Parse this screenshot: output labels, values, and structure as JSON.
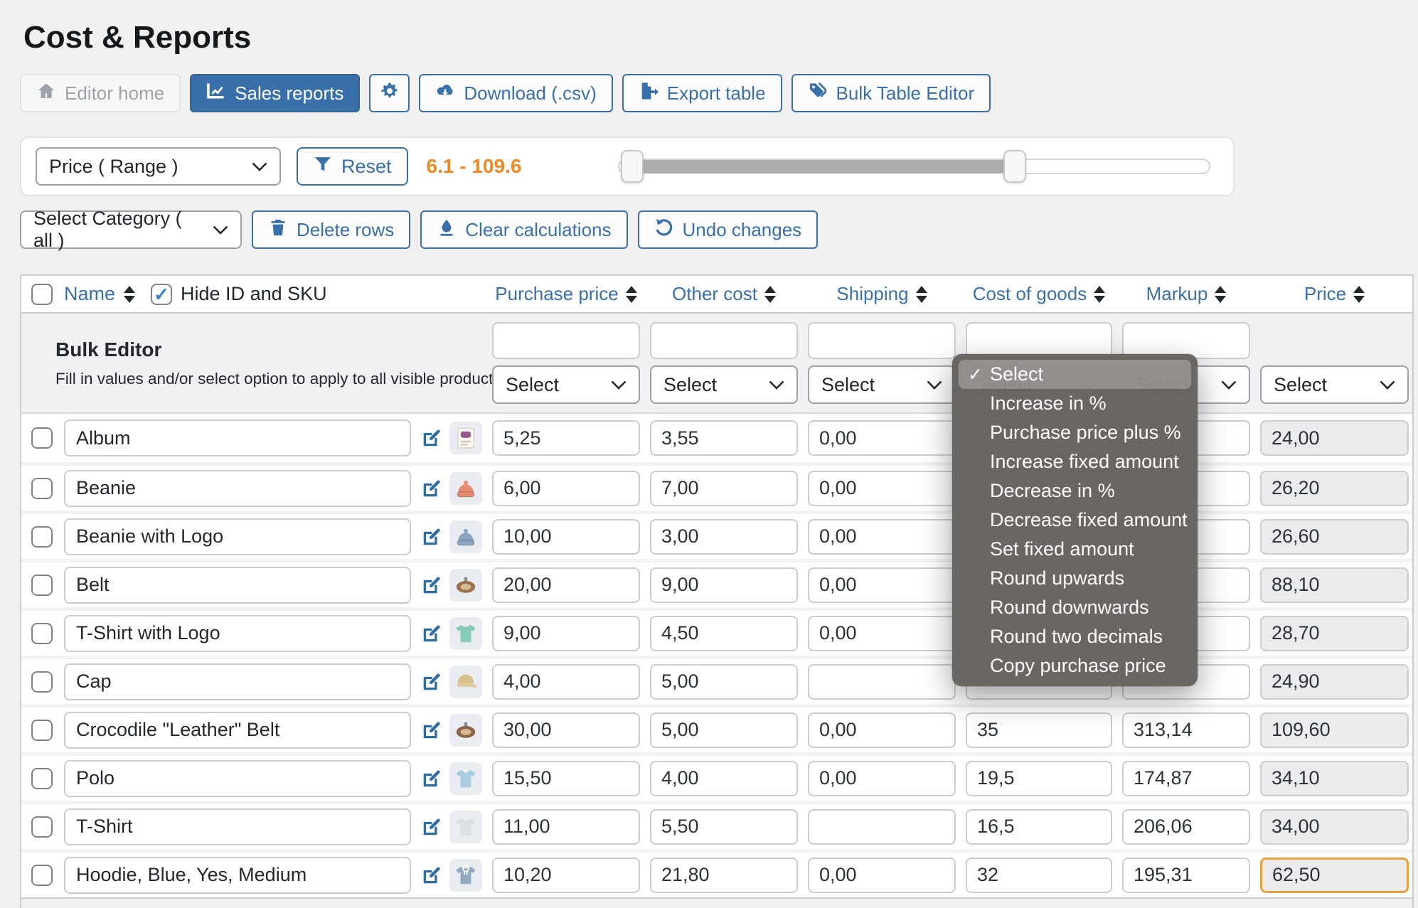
{
  "colors": {
    "accent": "#3a70a9",
    "range_text": "#ee8822",
    "price_highlight_border": "#e8a13b",
    "menu_background": "#67615d"
  },
  "page": {
    "title": "Cost & Reports"
  },
  "toolbar": {
    "editor_home": "Editor home",
    "sales_reports": "Sales reports",
    "download": "Download (.csv)",
    "export_table": "Export table",
    "bulk_table_editor": "Bulk Table Editor"
  },
  "filter_panel": {
    "field_select": "Price ( Range )",
    "reset_label": "Reset",
    "range_text": "6.1 - 109.6",
    "slider": {
      "left_pct": 2.4,
      "right_pct": 67
    }
  },
  "actions_row": {
    "category_select": "Select Category ( all )",
    "delete_rows": "Delete rows",
    "clear_calculations": "Clear calculations",
    "undo_changes": "Undo changes"
  },
  "table": {
    "name_header": "Name",
    "hide_id_label": "Hide ID and SKU",
    "columns": [
      "Purchase price",
      "Other cost",
      "Shipping",
      "Cost of goods",
      "Markup",
      "Price"
    ],
    "bulk": {
      "title": "Bulk Editor",
      "subtitle": "Fill in values and/or select option to apply to all visible products",
      "select_label": "Select"
    },
    "rows": [
      {
        "name": "Album",
        "purchase": "5,25",
        "other": "3,55",
        "shipping": "0,00",
        "cost": "",
        "markup": "",
        "price": "24,00",
        "price_highlight": false,
        "thumb": {
          "type": "album",
          "color": "#96588a"
        }
      },
      {
        "name": "Beanie",
        "purchase": "6,00",
        "other": "7,00",
        "shipping": "0,00",
        "cost": "",
        "markup": "",
        "price": "26,20",
        "price_highlight": false,
        "thumb": {
          "type": "beanie",
          "color": "#e88a70"
        }
      },
      {
        "name": "Beanie with Logo",
        "purchase": "10,00",
        "other": "3,00",
        "shipping": "0,00",
        "cost": "",
        "markup": "",
        "price": "26,60",
        "price_highlight": false,
        "thumb": {
          "type": "beanie",
          "color": "#8aa6c0"
        }
      },
      {
        "name": "Belt",
        "purchase": "20,00",
        "other": "9,00",
        "shipping": "0,00",
        "cost": "",
        "markup": "",
        "price": "88,10",
        "price_highlight": false,
        "thumb": {
          "type": "belt",
          "color": "#9a7150"
        }
      },
      {
        "name": "T-Shirt with Logo",
        "purchase": "9,00",
        "other": "4,50",
        "shipping": "0,00",
        "cost": "",
        "markup": "",
        "price": "28,70",
        "price_highlight": false,
        "thumb": {
          "type": "shirt",
          "color": "#86cbb5"
        }
      },
      {
        "name": "Cap",
        "purchase": "4,00",
        "other": "5,00",
        "shipping": "",
        "cost": "",
        "markup": "",
        "price": "24,90",
        "price_highlight": false,
        "thumb": {
          "type": "cap",
          "color": "#d9c08c"
        }
      },
      {
        "name": "Crocodile \"Leather\" Belt",
        "purchase": "30,00",
        "other": "5,00",
        "shipping": "0,00",
        "cost": "35",
        "markup": "313,14",
        "price": "109,60",
        "price_highlight": false,
        "thumb": {
          "type": "belt",
          "color": "#8a6444"
        }
      },
      {
        "name": "Polo",
        "purchase": "15,50",
        "other": "4,00",
        "shipping": "0,00",
        "cost": "19,5",
        "markup": "174,87",
        "price": "34,10",
        "price_highlight": false,
        "thumb": {
          "type": "polo",
          "color": "#a8cde2"
        }
      },
      {
        "name": "T-Shirt",
        "purchase": "11,00",
        "other": "5,50",
        "shipping": "",
        "cost": "16,5",
        "markup": "206,06",
        "price": "34,00",
        "price_highlight": false,
        "thumb": {
          "type": "shirt",
          "color": "#dcdfe2"
        }
      },
      {
        "name": "Hoodie, Blue, Yes, Medium",
        "purchase": "10,20",
        "other": "21,80",
        "shipping": "0,00",
        "cost": "32",
        "markup": "195,31",
        "price": "62,50",
        "price_highlight": true,
        "thumb": {
          "type": "hoodie",
          "color": "#93a9c0"
        }
      }
    ]
  },
  "dropdown_menu": {
    "selected": "Select",
    "items": [
      "Select",
      "Increase in %",
      "Purchase price plus %",
      "Increase fixed amount",
      "Decrease in %",
      "Decrease fixed amount",
      "Set fixed amount",
      "Round upwards",
      "Round downwards",
      "Round two decimals",
      "Copy purchase price"
    ]
  }
}
